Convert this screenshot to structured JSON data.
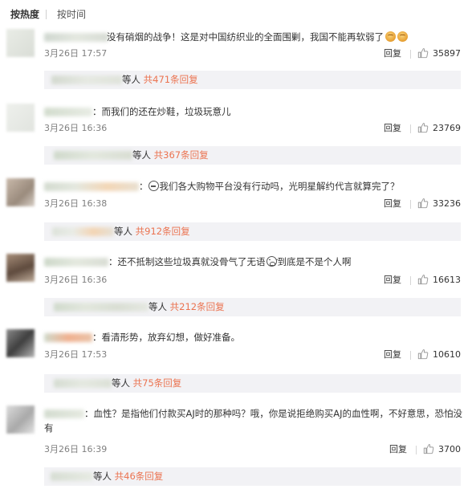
{
  "tabs": {
    "hot": "按热度",
    "time": "按时间"
  },
  "reply_label": "回复",
  "sub_prefix": "等人",
  "comments": [
    {
      "text": "没有硝烟的战争！这是对中国纺织业的全面围剿，我国不能再软弱了",
      "emoji_end": "fist-emoji",
      "time": "3月26日 17:57",
      "likes": "35897",
      "sub": "共471条回复"
    },
    {
      "text": "：而我们的还在炒鞋，垃圾玩意儿",
      "time": "3月26日 16:36",
      "likes": "23769",
      "sub": "共367条回复"
    },
    {
      "text_a": "：",
      "text_b": "我们各大购物平台没有行动吗，光明星解约代言就算完了？",
      "time": "3月26日 16:38",
      "likes": "33236",
      "sub": "共912条回复"
    },
    {
      "text_a": "：还不抵制这些垃圾真就没骨气了无语",
      "text_b": "到底是不是个人啊",
      "time": "3月26日 16:36",
      "likes": "16613",
      "sub": "共212条回复"
    },
    {
      "text": "：看清形势，放弃幻想，做好准备。",
      "time": "3月26日 17:53",
      "likes": "10610",
      "sub": "共75条回复"
    },
    {
      "text": "：血性？是指他们付款买AJ时的那种吗？哦，你是说拒绝购买AJ的血性啊，不好意思，恐怕没有",
      "time": "3月26日 16:39",
      "likes": "3700",
      "sub": "共46条回复"
    }
  ],
  "colors": {
    "link": "#eb7350",
    "subbox_bg": "#f2f2f5",
    "meta": "#808080"
  }
}
